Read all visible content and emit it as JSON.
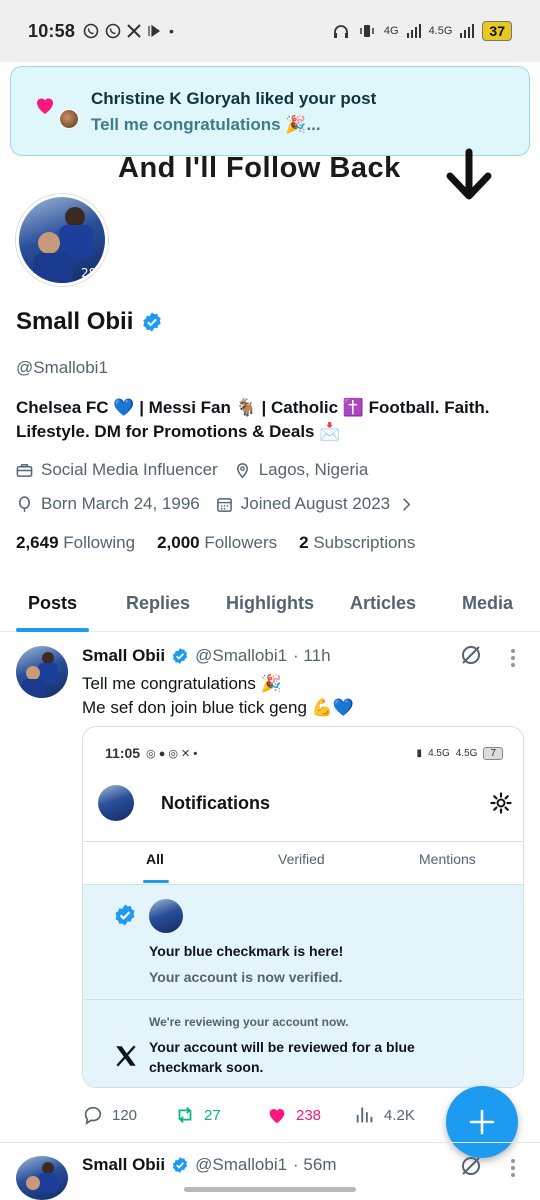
{
  "status_bar": {
    "time": "10:58",
    "battery": "37",
    "network_labels": [
      "4G",
      "4.5G"
    ]
  },
  "notification": {
    "title": "Christine K Gloryah liked your post",
    "message": "Tell me congratulations 🎉..."
  },
  "header_banner": {
    "text": "And I'll Follow Back"
  },
  "profile": {
    "name": "Small Obii",
    "handle": "@Smallobi1",
    "bio": "Chelsea FC 💙 | Messi Fan 🐐 | Catholic ✝️  Football. Faith. Lifestyle. DM for Promotions & Deals 📩",
    "category": "Social Media Influencer",
    "location": "Lagos, Nigeria",
    "born": "Born March 24, 1996",
    "joined": "Joined August 2023",
    "following_count": "2,649",
    "following_label": "Following",
    "followers_count": "2,000",
    "followers_label": "Followers",
    "subscriptions_count": "2",
    "subscriptions_label": "Subscriptions"
  },
  "tabs": [
    "Posts",
    "Replies",
    "Highlights",
    "Articles",
    "Media"
  ],
  "active_tab": "Posts",
  "posts": [
    {
      "name": "Small Obii",
      "handle": "@Smallobi1",
      "time": "· 11h",
      "text_line1": "Tell me congratulations 🎉",
      "text_line2": "Me sef don join blue tick geng 💪💙",
      "replies": "120",
      "reposts": "27",
      "likes": "238",
      "views": "4.2K"
    },
    {
      "name": "Small Obii",
      "handle": "@Smallobi1",
      "time": "· 56m"
    }
  ],
  "embedded_screenshot": {
    "time": "11:05",
    "battery": "7",
    "network_labels": [
      "4.5G",
      "4.5G"
    ],
    "title": "Notifications",
    "tabs": [
      "All",
      "Verified",
      "Mentions"
    ],
    "active_tab": "All",
    "notification1_title": "Your blue checkmark is here!",
    "notification1_sub": "Your account is now verified.",
    "notification2_pre": "We're reviewing your account now.",
    "notification2_text": "Your account will be reviewed for a blue checkmark soon."
  },
  "colors": {
    "accent": "#1d9bf0",
    "repost": "#00ba7c",
    "like": "#f91880",
    "banner_bg": "#dff6fb"
  }
}
